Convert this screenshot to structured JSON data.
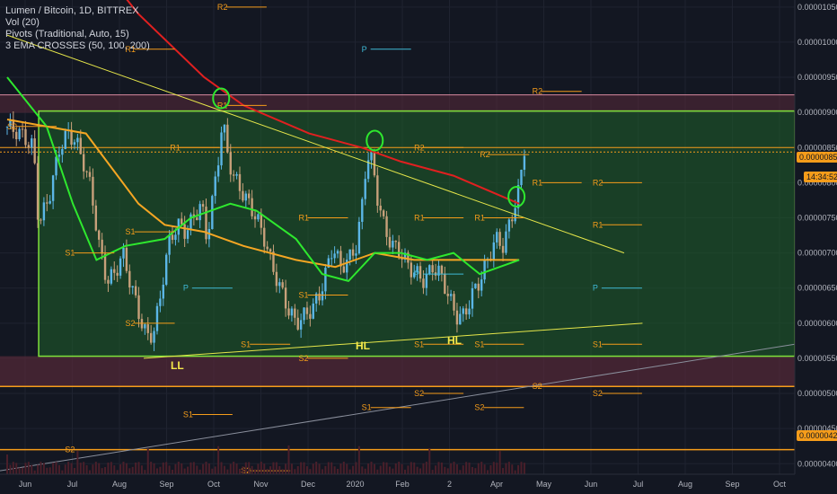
{
  "legend": {
    "title": "Lumen / Bitcoin, 1D, BITTREX",
    "vol": "Vol (20)",
    "pivots": "Pivots (Traditional, Auto, 15)",
    "ema": "3 EMA CROSSES (50, 100, 200)"
  },
  "price_badges": {
    "current": "0.00000852",
    "countdown": "14:34:52",
    "level_420": "0.00000420"
  },
  "annotations": [
    "LL",
    "HL",
    "HL"
  ],
  "chart_data": {
    "type": "candlestick",
    "title": "Lumen / Bitcoin, 1D, BITTREX",
    "y_ticks": [
      "0.00001050",
      "0.00001000",
      "0.00000950",
      "0.00000900",
      "0.00000850",
      "0.00000800",
      "0.00000750",
      "0.00000700",
      "0.00000650",
      "0.00000600",
      "0.00000550",
      "0.00000500",
      "0.00000450",
      "0.00000400"
    ],
    "x_ticks": [
      "Jun",
      "Jul",
      "Aug",
      "Sep",
      "Oct",
      "Nov",
      "Dec",
      "2020",
      "Feb",
      "2",
      "Apr",
      "May",
      "Jun",
      "Jul",
      "Aug",
      "Sep",
      "Oct"
    ],
    "ylim": [
      3.85e-06,
      1.06e-05
    ],
    "current_price": 8.52e-06,
    "price_path": [
      [
        0.0,
        8.8e-06
      ],
      [
        0.5,
        8.7e-06
      ],
      [
        1.0,
        8.5e-06
      ],
      [
        1.2,
        7.4e-06
      ],
      [
        1.6,
        7.8e-06
      ],
      [
        2.0,
        8.5e-06
      ],
      [
        2.3,
        8.7e-06
      ],
      [
        2.6,
        8.6e-06
      ],
      [
        2.9,
        8.3e-06
      ],
      [
        3.2,
        7.9e-06
      ],
      [
        3.5,
        7.1e-06
      ],
      [
        3.8,
        6.6e-06
      ],
      [
        4.1,
        6.7e-06
      ],
      [
        4.4,
        7e-06
      ],
      [
        4.6,
        6.7e-06
      ],
      [
        4.9,
        6.3e-06
      ],
      [
        5.2,
        5.9e-06
      ],
      [
        5.4,
        5.8e-06
      ],
      [
        5.6,
        5.9e-06
      ],
      [
        5.8,
        6.3e-06
      ],
      [
        6.0,
        6.8e-06
      ],
      [
        6.2,
        7.2e-06
      ],
      [
        6.5,
        7.4e-06
      ],
      [
        6.8,
        7.3e-06
      ],
      [
        7.1,
        7.5e-06
      ],
      [
        7.4,
        7.7e-06
      ],
      [
        7.6,
        7.2e-06
      ],
      [
        7.8,
        7.7e-06
      ],
      [
        8.0,
        8.2e-06
      ],
      [
        8.2,
        8.9e-06
      ],
      [
        8.4,
        8.4e-06
      ],
      [
        8.6,
        8.1e-06
      ],
      [
        8.9,
        7.9e-06
      ],
      [
        9.2,
        7.7e-06
      ],
      [
        9.5,
        7.5e-06
      ],
      [
        9.8,
        7.2e-06
      ],
      [
        10.1,
        6.8e-06
      ],
      [
        10.4,
        6.5e-06
      ],
      [
        10.7,
        6.2e-06
      ],
      [
        11.0,
        6e-06
      ],
      [
        11.3,
        6.1e-06
      ],
      [
        11.6,
        6.2e-06
      ],
      [
        11.9,
        6.4e-06
      ],
      [
        12.2,
        6.8e-06
      ],
      [
        12.4,
        7.1e-06
      ],
      [
        12.7,
        6.8e-06
      ],
      [
        13.0,
        6.9e-06
      ],
      [
        13.3,
        7.1e-06
      ],
      [
        13.5,
        7.6e-06
      ],
      [
        13.7,
        8.4e-06
      ],
      [
        13.9,
        8.3e-06
      ],
      [
        14.1,
        7.8e-06
      ],
      [
        14.4,
        7.3e-06
      ],
      [
        14.7,
        7.1e-06
      ],
      [
        15.0,
        7e-06
      ],
      [
        15.3,
        6.8e-06
      ],
      [
        15.6,
        6.7e-06
      ],
      [
        15.9,
        6.6e-06
      ],
      [
        16.2,
        6.8e-06
      ],
      [
        16.5,
        6.7e-06
      ],
      [
        16.8,
        6.4e-06
      ],
      [
        17.1,
        6.1e-06
      ],
      [
        17.4,
        6.1e-06
      ],
      [
        17.7,
        6.4e-06
      ],
      [
        18.0,
        6.6e-06
      ],
      [
        18.3,
        6.9e-06
      ],
      [
        18.6,
        7.2e-06
      ],
      [
        18.9,
        7.1e-06
      ],
      [
        19.2,
        7.5e-06
      ],
      [
        19.5,
        7.9e-06
      ],
      [
        19.7,
        8.5e-06
      ]
    ],
    "ema_50": [
      [
        0,
        8.9e-06
      ],
      [
        3,
        8.7e-06
      ],
      [
        5,
        7.7e-06
      ],
      [
        6,
        7.4e-06
      ],
      [
        7.5,
        7.3e-06
      ],
      [
        9,
        7.1e-06
      ],
      [
        11,
        6.9e-06
      ],
      [
        12.5,
        6.8e-06
      ],
      [
        14,
        7e-06
      ],
      [
        15.5,
        6.9e-06
      ],
      [
        17,
        6.9e-06
      ],
      [
        19.5,
        6.9e-06
      ]
    ],
    "ema_100": [
      [
        0,
        9.5e-06
      ],
      [
        1.5,
        8.8e-06
      ],
      [
        2.5,
        7.7e-06
      ],
      [
        3.4,
        6.9e-06
      ],
      [
        4.5,
        7.1e-06
      ],
      [
        6,
        7.2e-06
      ],
      [
        7,
        7.5e-06
      ],
      [
        8.5,
        7.7e-06
      ],
      [
        9.5,
        7.6e-06
      ],
      [
        11,
        7.2e-06
      ],
      [
        12,
        6.7e-06
      ],
      [
        13,
        6.6e-06
      ],
      [
        14,
        7e-06
      ],
      [
        15,
        7e-06
      ],
      [
        16,
        6.9e-06
      ],
      [
        17,
        7e-06
      ],
      [
        18,
        6.7e-06
      ],
      [
        19.5,
        6.9e-06
      ]
    ],
    "ema_200": [
      [
        0,
        1.38e-05
      ],
      [
        2,
        1.18e-05
      ],
      [
        5,
        1.04e-05
      ],
      [
        7.5,
        9.5e-06
      ],
      [
        9,
        9.1e-06
      ],
      [
        11.5,
        8.7e-06
      ],
      [
        13.5,
        8.5e-06
      ],
      [
        15,
        8.3e-06
      ],
      [
        17,
        8.1e-06
      ],
      [
        19.5,
        7.7e-06
      ]
    ],
    "x_domain": [
      0,
      30
    ],
    "box_top": 9.02e-06,
    "box_bottom": 5.53e-06,
    "upper_band": 9.25e-06,
    "resistance_852": 8.5e-06,
    "lower_band_top": 5.53e-06,
    "lower_band_bottom": 5.1e-06,
    "grid": true,
    "legend_position": "top-left"
  },
  "pivots": [
    {
      "label": "R2",
      "x": 8.0,
      "y": 1.05e-05
    },
    {
      "label": "S2",
      "x": 0.0,
      "y": 8.8e-06
    },
    {
      "label": "R1",
      "x": 4.5,
      "y": 9.9e-06
    },
    {
      "label": "P",
      "x": 13.5,
      "y": 9.9e-06
    },
    {
      "label": "R2",
      "x": 20.0,
      "y": 9.3e-06
    },
    {
      "label": "R1",
      "x": 8.0,
      "y": 9.1e-06
    },
    {
      "label": "R1",
      "x": 6.2,
      "y": 8.5e-06
    },
    {
      "label": "R2",
      "x": 15.5,
      "y": 8.5e-06
    },
    {
      "label": "R2",
      "x": 18.0,
      "y": 8.4e-06
    },
    {
      "label": "R1",
      "x": 20.0,
      "y": 8e-06
    },
    {
      "label": "R2",
      "x": 22.3,
      "y": 8e-06
    },
    {
      "label": "S1",
      "x": 4.5,
      "y": 7.3e-06
    },
    {
      "label": "R1",
      "x": 11.1,
      "y": 7.5e-06
    },
    {
      "label": "R1",
      "x": 15.5,
      "y": 7.5e-06
    },
    {
      "label": "R1",
      "x": 17.8,
      "y": 7.5e-06
    },
    {
      "label": "R1",
      "x": 22.3,
      "y": 7.4e-06
    },
    {
      "label": "S1",
      "x": 2.2,
      "y": 7e-06
    },
    {
      "label": "P",
      "x": 6.7,
      "y": 6.5e-06
    },
    {
      "label": "P",
      "x": 15.5,
      "y": 6.7e-06
    },
    {
      "label": "P",
      "x": 22.3,
      "y": 6.5e-06
    },
    {
      "label": "S1",
      "x": 11.1,
      "y": 6.4e-06
    },
    {
      "label": "S2",
      "x": 4.5,
      "y": 6e-06
    },
    {
      "label": "S1",
      "x": 8.9,
      "y": 5.7e-06
    },
    {
      "label": "S1",
      "x": 15.5,
      "y": 5.7e-06
    },
    {
      "label": "S1",
      "x": 17.8,
      "y": 5.7e-06
    },
    {
      "label": "S1",
      "x": 22.3,
      "y": 5.7e-06
    },
    {
      "label": "S2",
      "x": 11.1,
      "y": 5.5e-06
    },
    {
      "label": "S2",
      "x": 15.5,
      "y": 5e-06
    },
    {
      "label": "S2",
      "x": 20.0,
      "y": 5.1e-06
    },
    {
      "label": "S2",
      "x": 22.3,
      "y": 5e-06
    },
    {
      "label": "S1",
      "x": 13.5,
      "y": 4.8e-06
    },
    {
      "label": "S2",
      "x": 17.8,
      "y": 4.8e-06
    },
    {
      "label": "S1",
      "x": 6.7,
      "y": 4.7e-06
    },
    {
      "label": "S2",
      "x": 2.2,
      "y": 4.2e-06
    },
    {
      "label": "S2",
      "x": 8.9,
      "y": 3.9e-06
    }
  ],
  "colors": {
    "background": "#131722",
    "box_fill": "#1e5a2a",
    "box_stroke": "#7fe33b",
    "trend": "#e6e64a",
    "ema_50": "#f5a623",
    "ema_100": "#2ee82e",
    "ema_200": "#e02020",
    "band": "#5a2a3a",
    "orange_line": "#f59c1a",
    "up": "#5bb6e6",
    "down": "#c7a07a"
  }
}
